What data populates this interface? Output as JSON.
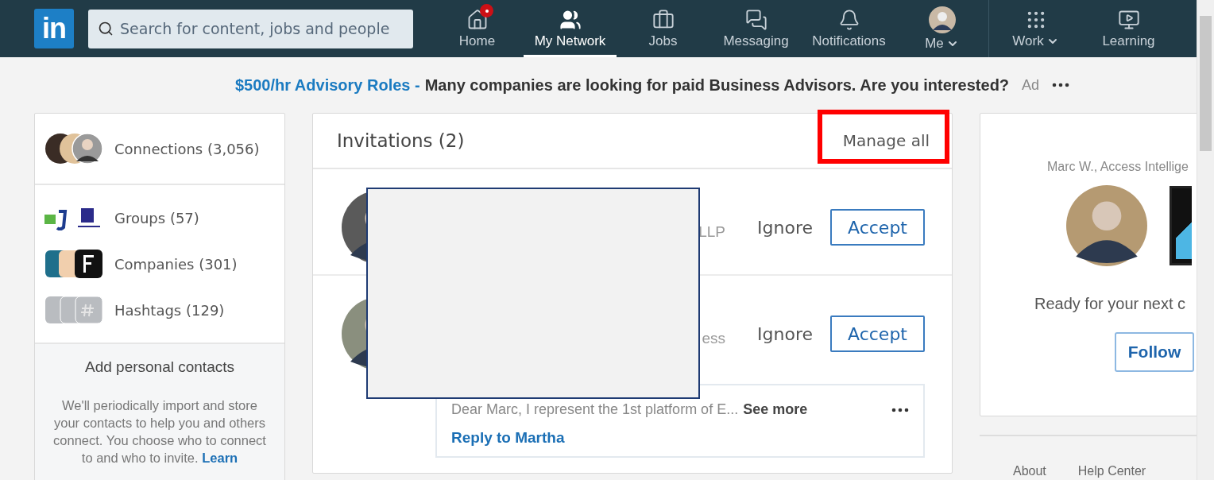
{
  "nav": {
    "logo": "in",
    "search": {
      "placeholder": "Search for content, jobs and people"
    },
    "items": [
      {
        "label": "Home",
        "kind": "home",
        "selected": false,
        "badge": true,
        "dropdown": false
      },
      {
        "label": "My Network",
        "kind": "network",
        "selected": true,
        "badge": false,
        "dropdown": false
      },
      {
        "label": "Jobs",
        "kind": "jobs",
        "selected": false,
        "badge": false,
        "dropdown": false
      },
      {
        "label": "Messaging",
        "kind": "messaging",
        "selected": false,
        "badge": false,
        "dropdown": false
      },
      {
        "label": "Notifications",
        "kind": "notifications",
        "selected": false,
        "badge": false,
        "dropdown": false
      },
      {
        "label": "Me",
        "kind": "me",
        "selected": false,
        "badge": false,
        "dropdown": true
      },
      {
        "label": "Work",
        "kind": "work",
        "selected": false,
        "badge": false,
        "dropdown": true
      },
      {
        "label": "Learning",
        "kind": "learning",
        "selected": false,
        "badge": false,
        "dropdown": false
      }
    ]
  },
  "ad": {
    "link": "$500/hr Advisory Roles -",
    "text": "Many companies are looking for paid Business Advisors. Are you interested?",
    "tag": "Ad"
  },
  "sidebar": {
    "items": [
      {
        "label": "Connections (3,056)",
        "kind": "connections"
      },
      {
        "label": "Groups (57)",
        "kind": "groups"
      },
      {
        "label": "Companies (301)",
        "kind": "companies"
      },
      {
        "label": "Hashtags (129)",
        "kind": "hashtags"
      }
    ],
    "contacts": {
      "title": "Add personal contacts",
      "body": "We'll periodically import and store your contacts to help you and others connect. You choose who to connect to and who to invite.",
      "link": "Learn"
    }
  },
  "invitations": {
    "title": "Invitations (2)",
    "manage": "Manage all",
    "rows": [
      {
        "fragment": "LLP",
        "ignore": "Ignore",
        "accept": "Accept"
      },
      {
        "fragment": "ess",
        "ignore": "Ignore",
        "accept": "Accept",
        "message": {
          "text": "Dear Marc, I represent the 1st platform of E...",
          "see_more": "See more",
          "reply": "Reply to Martha"
        }
      }
    ]
  },
  "promo": {
    "sponsor": "Marc W., Access Intellige",
    "text": "Ready for your next c",
    "follow": "Follow"
  },
  "footer": {
    "links": [
      "About",
      "Help Center"
    ]
  }
}
